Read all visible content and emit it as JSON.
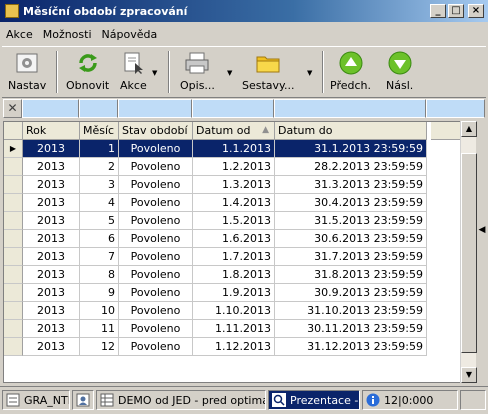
{
  "window": {
    "title": "Měsíční období zpracování"
  },
  "menu": [
    "Akce",
    "Možnosti",
    "Nápověda"
  ],
  "toolbar": {
    "nastav": "Nastav",
    "obnovit": "Obnovit",
    "akce": "Akce",
    "opis": "Opis...",
    "sestavy": "Sestavy...",
    "predch": "Předch.",
    "nasl": "Násl."
  },
  "grid": {
    "columns": [
      "Rok",
      "Měsíc",
      "Stav období",
      "Datum od",
      "Datum do"
    ],
    "rows": [
      [
        "2013",
        "1",
        "Povoleno",
        "1.1.2013",
        "31.1.2013 23:59:59"
      ],
      [
        "2013",
        "2",
        "Povoleno",
        "1.2.2013",
        "28.2.2013 23:59:59"
      ],
      [
        "2013",
        "3",
        "Povoleno",
        "1.3.2013",
        "31.3.2013 23:59:59"
      ],
      [
        "2013",
        "4",
        "Povoleno",
        "1.4.2013",
        "30.4.2013 23:59:59"
      ],
      [
        "2013",
        "5",
        "Povoleno",
        "1.5.2013",
        "31.5.2013 23:59:59"
      ],
      [
        "2013",
        "6",
        "Povoleno",
        "1.6.2013",
        "30.6.2013 23:59:59"
      ],
      [
        "2013",
        "7",
        "Povoleno",
        "1.7.2013",
        "31.7.2013 23:59:59"
      ],
      [
        "2013",
        "8",
        "Povoleno",
        "1.8.2013",
        "31.8.2013 23:59:59"
      ],
      [
        "2013",
        "9",
        "Povoleno",
        "1.9.2013",
        "30.9.2013 23:59:59"
      ],
      [
        "2013",
        "10",
        "Povoleno",
        "1.10.2013",
        "31.10.2013 23:59:59"
      ],
      [
        "2013",
        "11",
        "Povoleno",
        "1.11.2013",
        "30.11.2013 23:59:59"
      ],
      [
        "2013",
        "12",
        "Povoleno",
        "1.12.2013",
        "31.12.2013 23:59:59"
      ]
    ],
    "selected_row": 0
  },
  "statusbar": {
    "item1": "GRA_NTB",
    "item3": "DEMO od JED - pred optimalizací",
    "item4": "Prezentace - a",
    "item5": "12|0:000"
  },
  "colors": {
    "selection": "#0a246a",
    "filter": "#bfdcf7",
    "accent_green": "#6cc12a"
  }
}
